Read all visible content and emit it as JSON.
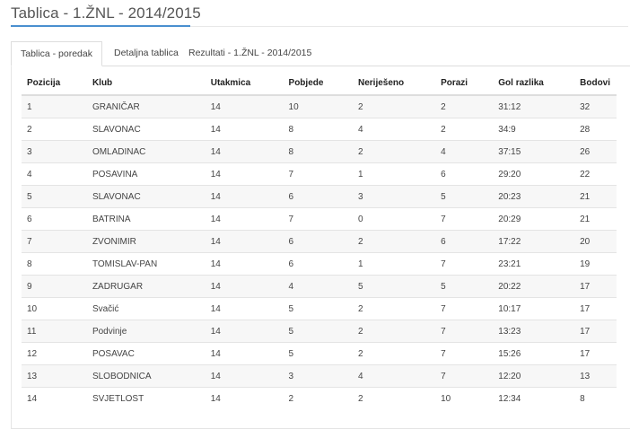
{
  "page": {
    "title": "Tablica - 1.ŽNL - 2014/2015"
  },
  "tabs": [
    {
      "label": "Tablica - poredak",
      "active": true
    },
    {
      "label": "Detaljna tablica",
      "active": false
    },
    {
      "label": "Rezultati - 1.ŽNL - 2014/2015",
      "active": false
    }
  ],
  "table": {
    "headers": [
      "Pozicija",
      "Klub",
      "Utakmica",
      "Pobjede",
      "Neriješeno",
      "Porazi",
      "Gol razlika",
      "Bodovi"
    ],
    "rows": [
      [
        "1",
        "GRANIČAR",
        "14",
        "10",
        "2",
        "2",
        "31:12",
        "32"
      ],
      [
        "2",
        "SLAVONAC",
        "14",
        "8",
        "4",
        "2",
        "34:9",
        "28"
      ],
      [
        "3",
        "OMLADINAC",
        "14",
        "8",
        "2",
        "4",
        "37:15",
        "26"
      ],
      [
        "4",
        "POSAVINA",
        "14",
        "7",
        "1",
        "6",
        "29:20",
        "22"
      ],
      [
        "5",
        "SLAVONAC",
        "14",
        "6",
        "3",
        "5",
        "20:23",
        "21"
      ],
      [
        "6",
        "BATRINA",
        "14",
        "7",
        "0",
        "7",
        "20:29",
        "21"
      ],
      [
        "7",
        "ZVONIMIR",
        "14",
        "6",
        "2",
        "6",
        "17:22",
        "20"
      ],
      [
        "8",
        "TOMISLAV-PAN",
        "14",
        "6",
        "1",
        "7",
        "23:21",
        "19"
      ],
      [
        "9",
        "ZADRUGAR",
        "14",
        "4",
        "5",
        "5",
        "20:22",
        "17"
      ],
      [
        "10",
        "Svačić",
        "14",
        "5",
        "2",
        "7",
        "10:17",
        "17"
      ],
      [
        "11",
        "Podvinje",
        "14",
        "5",
        "2",
        "7",
        "13:23",
        "17"
      ],
      [
        "12",
        "POSAVAC",
        "14",
        "5",
        "2",
        "7",
        "15:26",
        "17"
      ],
      [
        "13",
        "SLOBODNICA",
        "14",
        "3",
        "4",
        "7",
        "12:20",
        "13"
      ],
      [
        "14",
        "SVJETLOST",
        "14",
        "2",
        "2",
        "10",
        "12:34",
        "8"
      ]
    ]
  },
  "colors": {
    "accent": "#4a8fcf",
    "row_stripe": "#f7f7f7",
    "border": "#dddddd"
  }
}
